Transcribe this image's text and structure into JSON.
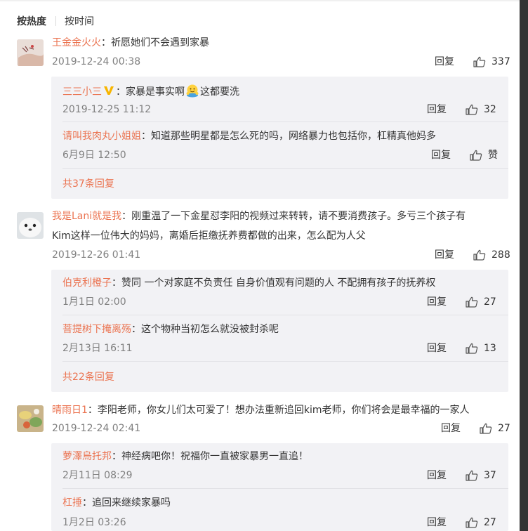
{
  "sort": {
    "hot": "按热度",
    "time": "按时间"
  },
  "comments": [
    {
      "name": "王金金火火",
      "sep": "：",
      "text": "祈愿她们不会遇到家暴",
      "time": "2019-12-24 00:38",
      "reply": "回复",
      "likes": "337",
      "subs": [
        {
          "name": "三三小三",
          "sep": "：",
          "text_a": "家暴是事实啊",
          "text_b": "这都要洗",
          "time": "2019-12-25 11:12",
          "reply": "回复",
          "likes": "32"
        },
        {
          "name": "请叫我肉丸小姐姐",
          "sep": "：",
          "text": "知道那些明星都是怎么死的吗，网络暴力也包括你，杠精真他妈多",
          "time": "6月9日 12:50",
          "reply": "回复",
          "likes": "赞"
        }
      ],
      "more": "共37条回复"
    },
    {
      "name": "我是Lani就是我",
      "sep": "：",
      "text": "刚重温了一下金星怼李阳的视频过来转转，请不要消费孩子。多亏三个孩子有",
      "text2": "Kim这样一位伟大的妈妈，离婚后拒缴抚养费都做的出来，怎么配为人父",
      "time": "2019-12-26 01:41",
      "reply": "回复",
      "likes": "288",
      "subs": [
        {
          "name": "伯克利橙子",
          "sep": "：",
          "text": "赞同 一个对家庭不负责任 自身价值观有问题的人 不配拥有孩子的抚养权",
          "time": "1月1日 02:00",
          "reply": "回复",
          "likes": "27"
        },
        {
          "name": "菩提树下掩离殇",
          "sep": "：",
          "text": "这个物种当初怎么就没被封杀呢",
          "time": "2月13日 16:11",
          "reply": "回复",
          "likes": "13"
        }
      ],
      "more": "共22条回复"
    },
    {
      "name": "晴雨日1",
      "sep": "：",
      "text": "李阳老师，你女儿们太可爱了！想办法重新追回kim老师，你们将会是最幸福的一家人",
      "time": "2019-12-24 02:41",
      "reply": "回复",
      "likes": "27",
      "subs": [
        {
          "name": "萝澤烏托邦",
          "sep": "：",
          "text": "神经病吧你！祝福你一直被家暴男一直追！",
          "time": "2月11日 08:29",
          "reply": "回复",
          "likes": "37"
        },
        {
          "name": "杠捶",
          "sep": "：",
          "text": "追回来继续家暴吗",
          "time": "1月2日 03:26",
          "reply": "回复",
          "likes": "27"
        }
      ]
    }
  ],
  "colors": {
    "name": "#eb7350",
    "time": "#808080",
    "subbox": "#f2f2f5",
    "badge": "#f7b500"
  },
  "icons": {
    "like": "thumbs-up-icon",
    "verified": "yellow-v-badge-icon",
    "emoji": "hug-emoji-icon"
  }
}
